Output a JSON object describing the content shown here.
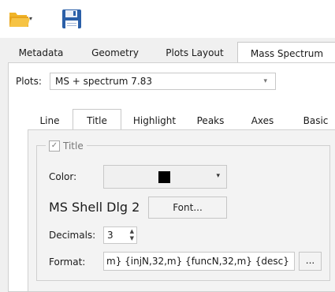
{
  "toolbar": {
    "open_icon": "folder-open-icon",
    "save_icon": "floppy-save-icon",
    "dropdown_arrow": "▾"
  },
  "main_tabs": [
    {
      "label": "Metadata",
      "active": false
    },
    {
      "label": "Geometry",
      "active": false
    },
    {
      "label": "Plots Layout",
      "active": false
    },
    {
      "label": "Mass Spectrum",
      "active": true
    }
  ],
  "plots": {
    "label": "Plots:",
    "selected": "MS + spectrum 7.83"
  },
  "sub_tabs": [
    {
      "label": "Line",
      "active": false
    },
    {
      "label": "Title",
      "active": true
    },
    {
      "label": "Highlight",
      "active": false
    },
    {
      "label": "Peaks",
      "active": false
    },
    {
      "label": "Axes",
      "active": false
    },
    {
      "label": "Basic",
      "active": false
    }
  ],
  "title_group": {
    "checkbox_label": "Title",
    "checked": true,
    "color_label": "Color:",
    "color_value": "#000000",
    "font_name": "MS Shell Dlg 2",
    "font_button": "Font...",
    "decimals_label": "Decimals:",
    "decimals_value": "3",
    "format_label": "Format:",
    "format_value": "m} {injN,32,m} {funcN,32,m} {desc}",
    "ellipsis_button": "..."
  },
  "colors": {
    "folder": "#f0b428",
    "floppy": "#2a5fa8"
  }
}
